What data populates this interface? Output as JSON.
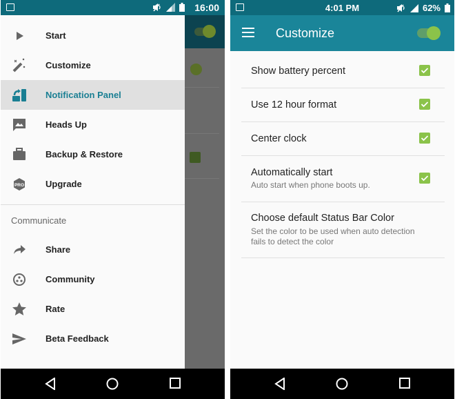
{
  "left": {
    "status": {
      "time": "16:00"
    },
    "drawer": {
      "items": [
        {
          "label": "Start",
          "icon": "play-icon"
        },
        {
          "label": "Customize",
          "icon": "magic-wand-icon"
        },
        {
          "label": "Notification Panel",
          "icon": "notification-panel-icon",
          "active": true
        },
        {
          "label": "Heads Up",
          "icon": "image-message-icon"
        },
        {
          "label": "Backup & Restore",
          "icon": "briefcase-icon"
        },
        {
          "label": "Upgrade",
          "icon": "pro-badge-icon"
        }
      ],
      "section_header": "Communicate",
      "section_items": [
        {
          "label": "Share",
          "icon": "share-icon"
        },
        {
          "label": "Community",
          "icon": "community-icon"
        },
        {
          "label": "Rate",
          "icon": "star-icon"
        },
        {
          "label": "Beta Feedback",
          "icon": "send-icon"
        }
      ]
    }
  },
  "right": {
    "status": {
      "time": "4:01 PM",
      "battery": "62%"
    },
    "toolbar": {
      "title": "Customize",
      "toggle_on": true
    },
    "settings": [
      {
        "title": "Show battery percent",
        "checked": true
      },
      {
        "title": "Use 12 hour format",
        "checked": true
      },
      {
        "title": "Center clock",
        "checked": true
      },
      {
        "title": "Automatically start",
        "summary": "Auto start when phone boots up.",
        "checked": true
      },
      {
        "title": "Choose default Status Bar Color",
        "summary_line1": "Set the color to be used when auto detection",
        "summary_line2": "fails to detect the color"
      }
    ]
  },
  "colors": {
    "status_bar": "#0e6a7b",
    "toolbar": "#1a8599",
    "accent_green": "#8bc34a",
    "active_text": "#1a7f93"
  }
}
